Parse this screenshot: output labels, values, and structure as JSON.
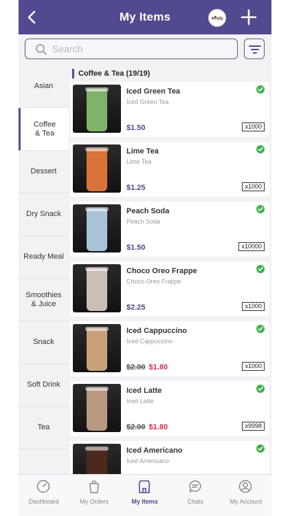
{
  "header": {
    "title": "My Items",
    "logo_text": "ผลิบุญ"
  },
  "search": {
    "placeholder": "Search"
  },
  "categories": [
    {
      "label": "Asian",
      "active": false
    },
    {
      "label": "Coffee\n& Tea",
      "active": true
    },
    {
      "label": "Dessert",
      "active": false
    },
    {
      "label": "Dry Snack",
      "active": false
    },
    {
      "label": "Ready Meal",
      "active": false
    },
    {
      "label": "Smoothies\n& Juice",
      "active": false
    },
    {
      "label": "Snack",
      "active": false
    },
    {
      "label": "Soft Drink",
      "active": false
    },
    {
      "label": "Tea",
      "active": false
    }
  ],
  "section": {
    "title": "Coffee & Tea (19/19)"
  },
  "items": [
    {
      "name": "Iced Green Tea",
      "subtitle": "Iced Green Tea",
      "price": "$1.50",
      "old_price": "",
      "sale_price": "",
      "stock": "x1000",
      "drink_color": "#7fb36a"
    },
    {
      "name": "Lime Tea",
      "subtitle": "Lime Tea",
      "price": "$1.25",
      "old_price": "",
      "sale_price": "",
      "stock": "x1000",
      "drink_color": "#d9733a"
    },
    {
      "name": "Peach Soda",
      "subtitle": "Peach Soda",
      "price": "$1.50",
      "old_price": "",
      "sale_price": "",
      "stock": "x10000",
      "drink_color": "#a9c3d6"
    },
    {
      "name": "Choco Oreo Frappe",
      "subtitle": "Choco Oreo Frappe",
      "price": "$2.25",
      "old_price": "",
      "sale_price": "",
      "stock": "x1000",
      "drink_color": "#c9bfb8"
    },
    {
      "name": "Iced Cappuccino",
      "subtitle": "Iced Cappuccino",
      "price": "",
      "old_price": "$2.00",
      "sale_price": "$1.80",
      "stock": "x1000",
      "drink_color": "#c9a07a"
    },
    {
      "name": "Iced Latte",
      "subtitle": "Iced Latte",
      "price": "",
      "old_price": "$2.00",
      "sale_price": "$1.80",
      "stock": "x9998",
      "drink_color": "#b89a80"
    },
    {
      "name": "Iced Americano",
      "subtitle": "Iced Americano",
      "price": "",
      "old_price": "",
      "sale_price": "",
      "stock": "",
      "drink_color": "#4a2a1c"
    }
  ],
  "tabs": [
    {
      "label": "Dashboard",
      "icon": "gauge-icon",
      "active": false
    },
    {
      "label": "My Orders",
      "icon": "bag-icon",
      "active": false
    },
    {
      "label": "My Items",
      "icon": "store-icon",
      "active": true
    },
    {
      "label": "Chats",
      "icon": "chat-icon",
      "active": false
    },
    {
      "label": "My Account",
      "icon": "account-icon",
      "active": false
    }
  ],
  "colors": {
    "brand": "#524a8f",
    "sale": "#d62f50",
    "available": "#3fb34f"
  }
}
